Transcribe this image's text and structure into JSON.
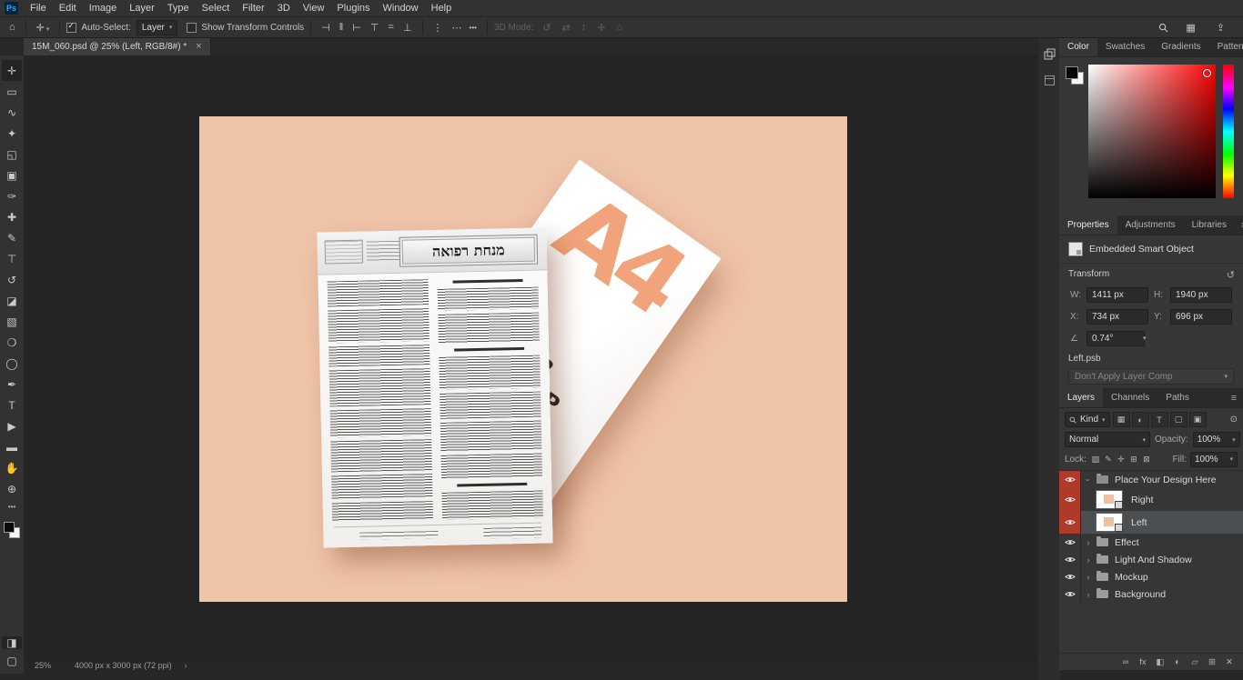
{
  "app": {
    "logo_text": "Ps"
  },
  "menu_bar": {
    "items": [
      "File",
      "Edit",
      "Image",
      "Layer",
      "Type",
      "Select",
      "Filter",
      "3D",
      "View",
      "Plugins",
      "Window",
      "Help"
    ]
  },
  "options_bar": {
    "auto_select_label": "Auto-Select:",
    "auto_select_value": "Layer",
    "show_transform_label": "Show Transform Controls",
    "more_glyph": "•••",
    "mode3d_label": "3D Mode:",
    "move_tool_glyph": "✛",
    "align_icons": [
      {
        "name": "align-left-icon",
        "glyph": "⊣"
      },
      {
        "name": "align-center-horizontal-icon",
        "glyph": "‖"
      },
      {
        "name": "align-right-icon",
        "glyph": "⊢"
      },
      {
        "name": "align-top-icon",
        "glyph": "⊤"
      },
      {
        "name": "align-center-vertical-icon",
        "glyph": "="
      },
      {
        "name": "align-bottom-icon",
        "glyph": "⊥"
      }
    ],
    "distribute_icons": [
      {
        "name": "distribute-vertical-icon",
        "glyph": "⋮"
      },
      {
        "name": "distribute-horizontal-icon",
        "glyph": "⋯"
      }
    ],
    "mode3d_icons": [
      {
        "name": "3d-rotate-icon",
        "glyph": "↺"
      },
      {
        "name": "3d-roll-icon",
        "glyph": "⇄"
      },
      {
        "name": "3d-drag-icon",
        "glyph": "↕"
      },
      {
        "name": "3d-slide-icon",
        "glyph": "✛"
      },
      {
        "name": "3d-scale-icon",
        "glyph": "⌂"
      }
    ],
    "workspace_glyph": "▦",
    "share_glyph": "⇪"
  },
  "document_tab": {
    "title": "15M_060.psd @ 25% (Left, RGB/8#) *",
    "close_glyph": "×"
  },
  "toolstrip": {
    "more_glyph": "•••",
    "tools": [
      {
        "name": "move-tool",
        "glyph": "✛"
      },
      {
        "name": "marquee-tool",
        "glyph": "▭"
      },
      {
        "name": "lasso-tool",
        "glyph": "∿"
      },
      {
        "name": "quick-selection-tool",
        "glyph": "✦"
      },
      {
        "name": "crop-tool",
        "glyph": "◱"
      },
      {
        "name": "frame-tool",
        "glyph": "▣"
      },
      {
        "name": "eyedropper-tool",
        "glyph": "✑"
      },
      {
        "name": "healing-brush-tool",
        "glyph": "✚"
      },
      {
        "name": "brush-tool",
        "glyph": "✎"
      },
      {
        "name": "clone-stamp-tool",
        "glyph": "⊤"
      },
      {
        "name": "history-brush-tool",
        "glyph": "↺"
      },
      {
        "name": "eraser-tool",
        "glyph": "◪"
      },
      {
        "name": "gradient-tool",
        "glyph": "▧"
      },
      {
        "name": "blur-tool",
        "glyph": "❍"
      },
      {
        "name": "dodge-tool",
        "glyph": "◯"
      },
      {
        "name": "pen-tool",
        "glyph": "✒"
      },
      {
        "name": "type-tool",
        "glyph": "T"
      },
      {
        "name": "path-selection-tool",
        "glyph": "▶"
      },
      {
        "name": "shape-tool",
        "glyph": "▬"
      },
      {
        "name": "hand-tool",
        "glyph": "✋"
      },
      {
        "name": "zoom-tool",
        "glyph": "⊕"
      }
    ],
    "quick_mask_glyph": "◨",
    "screen_mode_glyph": "▢"
  },
  "canvas": {
    "background_hex": "#f0c4a9",
    "accent_hex": "#f1a47b",
    "front_page_title": "מנחת רפואה",
    "back_sheet_letter": "A4",
    "back_sheet_lines": [
      "PSD",
      "COVER",
      "MOCKUP"
    ]
  },
  "color_panel": {
    "tabs": [
      {
        "label": "Color",
        "active": true
      },
      {
        "label": "Swatches"
      },
      {
        "label": "Gradients"
      },
      {
        "label": "Patterns"
      }
    ],
    "menu_glyph": "≡"
  },
  "properties_panel": {
    "tabs": [
      {
        "label": "Properties",
        "active": true
      },
      {
        "label": "Adjustments"
      },
      {
        "label": "Libraries"
      }
    ],
    "menu_glyph": "≡",
    "object_type": "Embedded Smart Object",
    "section_transform": "Transform",
    "reset_glyph": "↺",
    "w_label": "W:",
    "w_value": "1411 px",
    "h_label": "H:",
    "h_value": "1940 px",
    "x_label": "X:",
    "x_value": "734 px",
    "y_label": "Y:",
    "y_value": "696 px",
    "angle_icon": "∠",
    "angle_value": "0.74°",
    "file_name": "Left.psb",
    "layer_comp_value": "Don't Apply Layer Comp"
  },
  "layers_panel": {
    "tabs": [
      {
        "label": "Layers",
        "active": true
      },
      {
        "label": "Channels"
      },
      {
        "label": "Paths"
      }
    ],
    "menu_glyph": "≡",
    "kind_value": "Kind",
    "filter_icons": [
      {
        "name": "filter-pixel-layers-icon",
        "glyph": "▦"
      },
      {
        "name": "filter-adjustment-layers-icon",
        "glyph": "◐"
      },
      {
        "name": "filter-type-layers-icon",
        "glyph": "T"
      },
      {
        "name": "filter-shape-layers-icon",
        "glyph": "▢"
      },
      {
        "name": "filter-smart-objects-icon",
        "glyph": "▣"
      }
    ],
    "filter_toggle_glyph": "⊙",
    "blend_mode_value": "Normal",
    "opacity_label": "Opacity:",
    "opacity_value": "100%",
    "lock_label": "Lock:",
    "lock_icons": [
      {
        "name": "lock-transparency-icon",
        "glyph": "▨"
      },
      {
        "name": "lock-pixels-icon",
        "glyph": "✎"
      },
      {
        "name": "lock-position-icon",
        "glyph": "✛"
      },
      {
        "name": "lock-artboard-icon",
        "glyph": "⊞"
      },
      {
        "name": "lock-all-icon",
        "glyph": "⊠"
      }
    ],
    "fill_label": "Fill:",
    "fill_value": "100%",
    "layer_label_red_hex": "#b03a2a",
    "layers": [
      {
        "label": "Place Your Design Here",
        "kind": "group-open",
        "red": true
      },
      {
        "label": "Right",
        "kind": "thumb",
        "red": true
      },
      {
        "label": "Left",
        "kind": "thumb",
        "red": true,
        "selected": true
      },
      {
        "label": "Effect",
        "kind": "group"
      },
      {
        "label": "Light And Shadow",
        "kind": "group"
      },
      {
        "label": "Mockup",
        "kind": "group"
      },
      {
        "label": "Background",
        "kind": "group"
      }
    ],
    "footer_icons": [
      {
        "name": "link-layers-icon",
        "glyph": "∞"
      },
      {
        "name": "layer-effects-icon",
        "glyph": "fx"
      },
      {
        "name": "add-layer-mask-icon",
        "glyph": "◧"
      },
      {
        "name": "new-adjustment-layer-icon",
        "glyph": "◐"
      },
      {
        "name": "new-group-icon",
        "glyph": "▱"
      },
      {
        "name": "new-layer-icon",
        "glyph": "⊞"
      },
      {
        "name": "delete-layer-icon",
        "glyph": "✕"
      }
    ]
  },
  "status_bar": {
    "zoom": "25%",
    "doc_info": "4000 px x 3000 px (72 ppi)",
    "chevron": "›"
  }
}
